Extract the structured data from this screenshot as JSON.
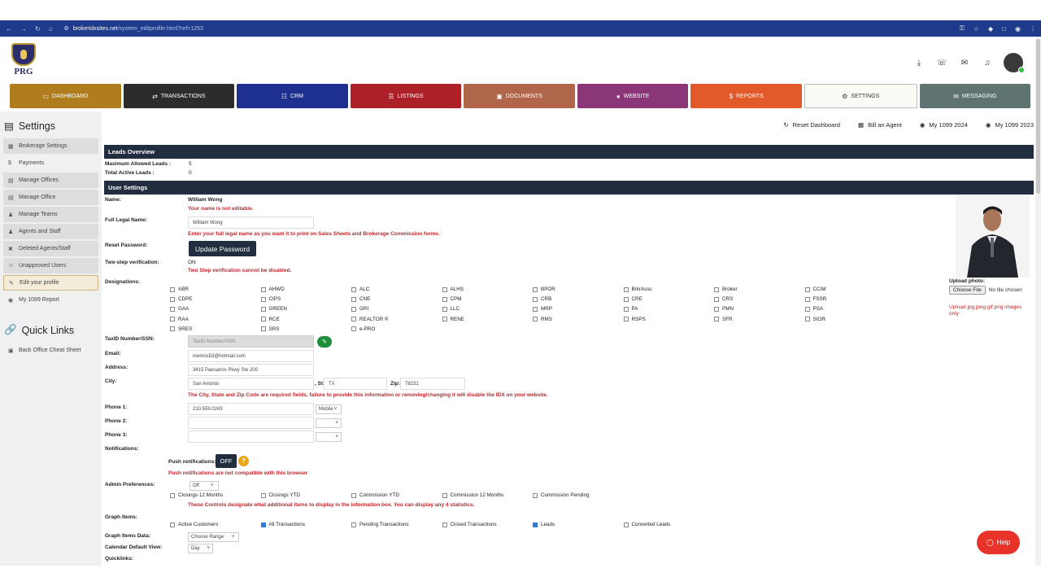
{
  "browser": {
    "domain": "brokeridxsites.net",
    "path": "/system_editprofile.html?ref=1253"
  },
  "logo": {
    "text": "PRG"
  },
  "tabs": [
    {
      "label": "DASHBOARD",
      "icon": "monitor-icon",
      "color": "#b07d1e"
    },
    {
      "label": "TRANSACTIONS",
      "icon": "exchange-icon",
      "color": "#2c2c2c"
    },
    {
      "label": "CRM",
      "icon": "sitemap-icon",
      "color": "#1d2f8f"
    },
    {
      "label": "LISTINGS",
      "icon": "list-icon",
      "color": "#ae2028"
    },
    {
      "label": "DOCUMENTS",
      "icon": "briefcase-icon",
      "color": "#b0664a"
    },
    {
      "label": "WEBSITE",
      "icon": "globe-icon",
      "color": "#8a3678"
    },
    {
      "label": "REPORTS",
      "icon": "dollar-icon",
      "color": "#e2592a"
    },
    {
      "label": "SETTINGS",
      "icon": "gear-icon",
      "color": "#fbfbf6"
    },
    {
      "label": "MESSAGING",
      "icon": "envelope-icon",
      "color": "#5f7470"
    }
  ],
  "sidebar": {
    "title": "Settings",
    "items": [
      {
        "label": "Brokerage Settings",
        "icon": "building-icon"
      },
      {
        "label": "Payments",
        "icon": "dollar-icon"
      },
      {
        "label": "Manage Offices",
        "icon": "office-icon"
      },
      {
        "label": "Manage Office",
        "icon": "office-icon"
      },
      {
        "label": "Manage Teams",
        "icon": "users-icon"
      },
      {
        "label": "Agents and Staff",
        "icon": "users-icon"
      },
      {
        "label": "Deleted Agents/Staff",
        "icon": "user-x-icon"
      },
      {
        "label": "Unapproved Users",
        "icon": "user-icon"
      },
      {
        "label": "Edit your profile",
        "icon": "pencil-icon"
      },
      {
        "label": "My 1099 Report",
        "icon": "eye-icon"
      }
    ],
    "quick_title": "Quick Links",
    "quick_items": [
      {
        "label": "Back Office Cheat Sheet",
        "icon": "briefcase-icon"
      }
    ]
  },
  "actions": {
    "reset": "Reset Dashboard",
    "bill": "Bill an Agent",
    "my2024": "My 1099 2024",
    "my2023": "My 1099 2023"
  },
  "leads": {
    "title": "Leads Overview",
    "max_label": "Maximum Allowed Leads :",
    "max_value": "5",
    "active_label": "Total Active Leads :",
    "active_value": "0"
  },
  "user": {
    "title": "User Settings",
    "name_label": "Name:",
    "name_value": "William Wong",
    "name_note": "Your name is not editable.",
    "legal_label": "Full Legal Name:",
    "legal_value": "William  Wong",
    "legal_note": "Enter your full legal name as you want it to print on Sales Sheets and Brokerage Commission forms.",
    "reset_label": "Reset Password:",
    "update_btn": "Update Password",
    "twostep_label": "Two-step verification:",
    "twostep_value": "ON",
    "twostep_note": "Two Step verification cannot be disabled.",
    "designations_label": "Designations:",
    "designations": [
      "ABR",
      "AHWD",
      "ALC",
      "ALHS",
      "BPOR",
      "BrkrAssc",
      "Broker",
      "CCIM",
      "CDPE",
      "CIPS",
      "CNE",
      "CPM",
      "CRB",
      "CRE",
      "CRS",
      "FSSR",
      "GAA",
      "GREEN",
      "GRI",
      "LLC",
      "MRP",
      "PA",
      "PMN",
      "PSA",
      "RAA",
      "RCE",
      "REALTOR ®",
      "RENE",
      "RMS",
      "RSPS",
      "SFR",
      "SIOR",
      "SRES",
      "SRS",
      "e-PRO"
    ],
    "taxid_label": "TaxID Number/SSN:",
    "taxid_placeholder": "TaxID Number/SSN",
    "email_label": "Email:",
    "email_value": "memos53@hotmail.com",
    "address_label": "Address:",
    "address_value": "3415 Paesanos Pkwy Ste 200",
    "city_label": "City:",
    "city_value": "San Antonio",
    "st_label": ", St:",
    "st_value": "TX",
    "zip_label": "Zip:",
    "zip_value": "78231",
    "city_note": "The City, State and Zip Code are required fields, failure to provide this information or removing/changing it will disable the IDX on your website.",
    "phone1_label": "Phone 1:",
    "phone1_value": "210.559.0243",
    "phone1_type": "Mobile",
    "phone2_label": "Phone 2:",
    "phone3_label": "Phone 3:",
    "notifications_label": "Notifications:",
    "push_label": "Push notifications:",
    "push_btn": "OFF",
    "push_note": "Push notifications are not compatible with this browser",
    "admin_label": "Admin Preferences:",
    "admin_select": "Off",
    "admin_items": [
      "Closings 12 Months",
      "Closings YTD",
      "Commission YTD",
      "Commission 12 Months",
      "Commission Pending"
    ],
    "admin_note": "These Controls designate what additional items to display in the information box. You can display any 4 statistics.",
    "graph_label": "Graph Items:",
    "graph_items": [
      {
        "label": "Active Customers",
        "checked": false
      },
      {
        "label": "All Transactions",
        "checked": true
      },
      {
        "label": "Pending Transactions",
        "checked": false
      },
      {
        "label": "Closed Transactions",
        "checked": false
      },
      {
        "label": "Leads",
        "checked": true
      },
      {
        "label": "Converted Leads",
        "checked": false
      }
    ],
    "graph_data_label": "Graph Items Data:",
    "graph_data_select": "Choose Range",
    "calendar_label": "Calendar Default View:",
    "calendar_select": "Day",
    "quicklinks_label": "Quicklinks:",
    "upload_label": "Upload photo:",
    "choose_file": "Choose File",
    "no_file": "No file chosen",
    "upload_note": "Upload jpg,jpeg,gif,png images only"
  },
  "help": {
    "label": "Help"
  }
}
